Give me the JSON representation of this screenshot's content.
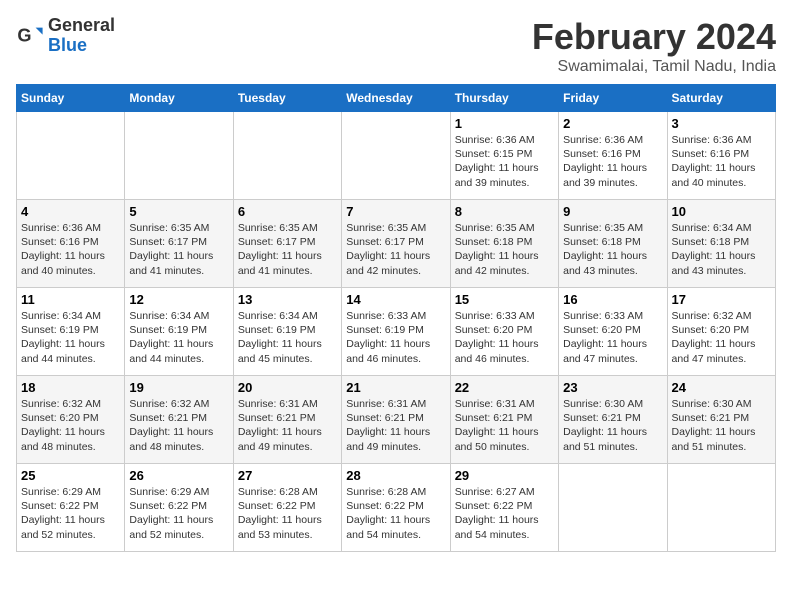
{
  "header": {
    "logo_general": "General",
    "logo_blue": "Blue",
    "title": "February 2024",
    "subtitle": "Swamimalai, Tamil Nadu, India"
  },
  "calendar": {
    "days_of_week": [
      "Sunday",
      "Monday",
      "Tuesday",
      "Wednesday",
      "Thursday",
      "Friday",
      "Saturday"
    ],
    "weeks": [
      [
        {
          "day": "",
          "info": ""
        },
        {
          "day": "",
          "info": ""
        },
        {
          "day": "",
          "info": ""
        },
        {
          "day": "",
          "info": ""
        },
        {
          "day": "1",
          "info": "Sunrise: 6:36 AM\nSunset: 6:15 PM\nDaylight: 11 hours and 39 minutes."
        },
        {
          "day": "2",
          "info": "Sunrise: 6:36 AM\nSunset: 6:16 PM\nDaylight: 11 hours and 39 minutes."
        },
        {
          "day": "3",
          "info": "Sunrise: 6:36 AM\nSunset: 6:16 PM\nDaylight: 11 hours and 40 minutes."
        }
      ],
      [
        {
          "day": "4",
          "info": "Sunrise: 6:36 AM\nSunset: 6:16 PM\nDaylight: 11 hours and 40 minutes."
        },
        {
          "day": "5",
          "info": "Sunrise: 6:35 AM\nSunset: 6:17 PM\nDaylight: 11 hours and 41 minutes."
        },
        {
          "day": "6",
          "info": "Sunrise: 6:35 AM\nSunset: 6:17 PM\nDaylight: 11 hours and 41 minutes."
        },
        {
          "day": "7",
          "info": "Sunrise: 6:35 AM\nSunset: 6:17 PM\nDaylight: 11 hours and 42 minutes."
        },
        {
          "day": "8",
          "info": "Sunrise: 6:35 AM\nSunset: 6:18 PM\nDaylight: 11 hours and 42 minutes."
        },
        {
          "day": "9",
          "info": "Sunrise: 6:35 AM\nSunset: 6:18 PM\nDaylight: 11 hours and 43 minutes."
        },
        {
          "day": "10",
          "info": "Sunrise: 6:34 AM\nSunset: 6:18 PM\nDaylight: 11 hours and 43 minutes."
        }
      ],
      [
        {
          "day": "11",
          "info": "Sunrise: 6:34 AM\nSunset: 6:19 PM\nDaylight: 11 hours and 44 minutes."
        },
        {
          "day": "12",
          "info": "Sunrise: 6:34 AM\nSunset: 6:19 PM\nDaylight: 11 hours and 44 minutes."
        },
        {
          "day": "13",
          "info": "Sunrise: 6:34 AM\nSunset: 6:19 PM\nDaylight: 11 hours and 45 minutes."
        },
        {
          "day": "14",
          "info": "Sunrise: 6:33 AM\nSunset: 6:19 PM\nDaylight: 11 hours and 46 minutes."
        },
        {
          "day": "15",
          "info": "Sunrise: 6:33 AM\nSunset: 6:20 PM\nDaylight: 11 hours and 46 minutes."
        },
        {
          "day": "16",
          "info": "Sunrise: 6:33 AM\nSunset: 6:20 PM\nDaylight: 11 hours and 47 minutes."
        },
        {
          "day": "17",
          "info": "Sunrise: 6:32 AM\nSunset: 6:20 PM\nDaylight: 11 hours and 47 minutes."
        }
      ],
      [
        {
          "day": "18",
          "info": "Sunrise: 6:32 AM\nSunset: 6:20 PM\nDaylight: 11 hours and 48 minutes."
        },
        {
          "day": "19",
          "info": "Sunrise: 6:32 AM\nSunset: 6:21 PM\nDaylight: 11 hours and 48 minutes."
        },
        {
          "day": "20",
          "info": "Sunrise: 6:31 AM\nSunset: 6:21 PM\nDaylight: 11 hours and 49 minutes."
        },
        {
          "day": "21",
          "info": "Sunrise: 6:31 AM\nSunset: 6:21 PM\nDaylight: 11 hours and 49 minutes."
        },
        {
          "day": "22",
          "info": "Sunrise: 6:31 AM\nSunset: 6:21 PM\nDaylight: 11 hours and 50 minutes."
        },
        {
          "day": "23",
          "info": "Sunrise: 6:30 AM\nSunset: 6:21 PM\nDaylight: 11 hours and 51 minutes."
        },
        {
          "day": "24",
          "info": "Sunrise: 6:30 AM\nSunset: 6:21 PM\nDaylight: 11 hours and 51 minutes."
        }
      ],
      [
        {
          "day": "25",
          "info": "Sunrise: 6:29 AM\nSunset: 6:22 PM\nDaylight: 11 hours and 52 minutes."
        },
        {
          "day": "26",
          "info": "Sunrise: 6:29 AM\nSunset: 6:22 PM\nDaylight: 11 hours and 52 minutes."
        },
        {
          "day": "27",
          "info": "Sunrise: 6:28 AM\nSunset: 6:22 PM\nDaylight: 11 hours and 53 minutes."
        },
        {
          "day": "28",
          "info": "Sunrise: 6:28 AM\nSunset: 6:22 PM\nDaylight: 11 hours and 54 minutes."
        },
        {
          "day": "29",
          "info": "Sunrise: 6:27 AM\nSunset: 6:22 PM\nDaylight: 11 hours and 54 minutes."
        },
        {
          "day": "",
          "info": ""
        },
        {
          "day": "",
          "info": ""
        }
      ]
    ]
  }
}
